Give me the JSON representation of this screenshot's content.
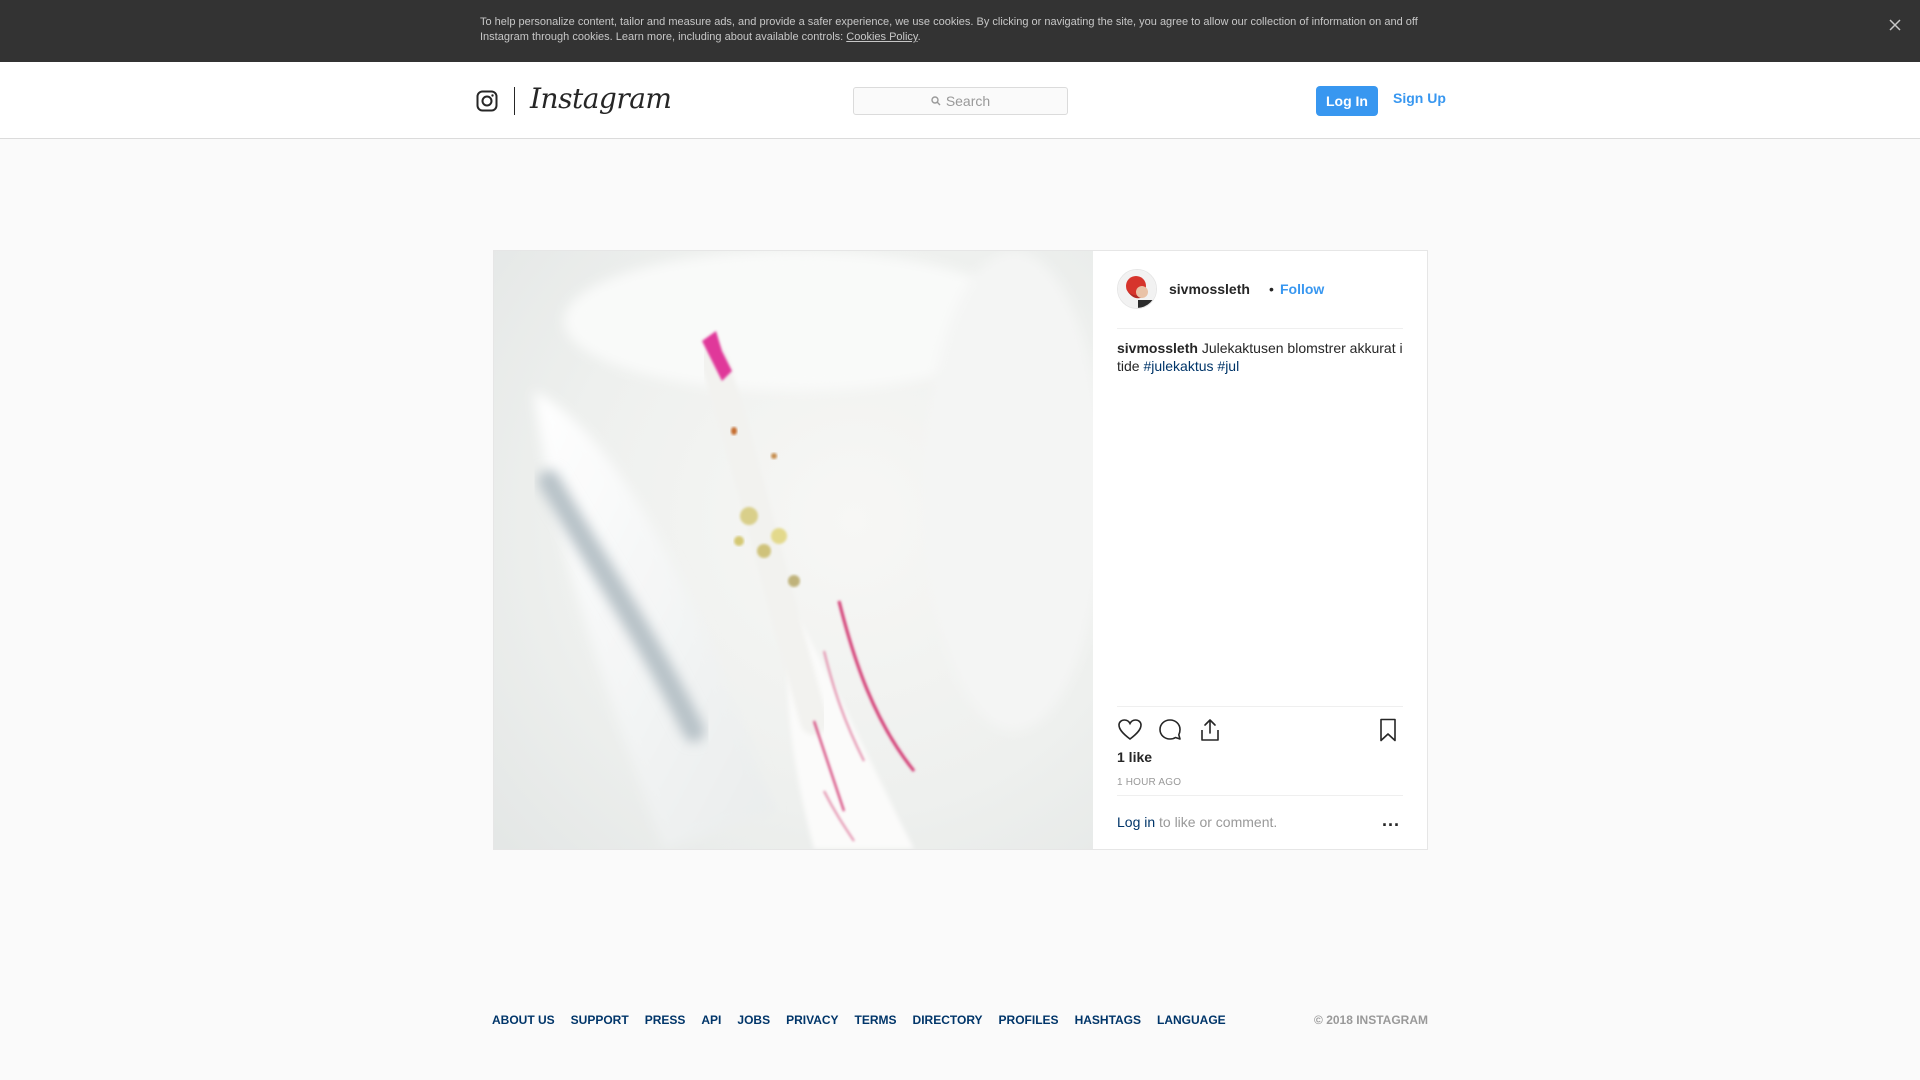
{
  "cookie_banner": {
    "text": "To help personalize content, tailor and measure ads, and provide a safer experience, we use cookies. By clicking or navigating the site, you agree to allow our collection of information on and off Instagram through cookies. Learn more, including about available controls: ",
    "link": "Cookies Policy",
    "suffix": "."
  },
  "header": {
    "wordmark": "Instagram",
    "search_placeholder": "Search",
    "login_label": "Log In",
    "signup_label": "Sign Up"
  },
  "post": {
    "username": "sivmossleth",
    "separator": "•",
    "follow_label": "Follow",
    "caption_user": "sivmossleth",
    "caption_text": "Julekaktusen blomstrer akkurat i tide",
    "hashtags": [
      "#julekaktus",
      "#jul"
    ],
    "likes": "1 like",
    "time": "1 HOUR AGO",
    "login_link": "Log in",
    "comment_prompt": "to like or comment.",
    "more_label": "..."
  },
  "footer": {
    "links": [
      "About us",
      "Support",
      "Press",
      "API",
      "Jobs",
      "Privacy",
      "Terms",
      "Directory",
      "Profiles",
      "Hashtags",
      "Language"
    ],
    "copyright": "© 2018 Instagram"
  },
  "colors": {
    "accent": "#3897f0",
    "link_dark": "#003569",
    "banner_bg": "#333333"
  }
}
